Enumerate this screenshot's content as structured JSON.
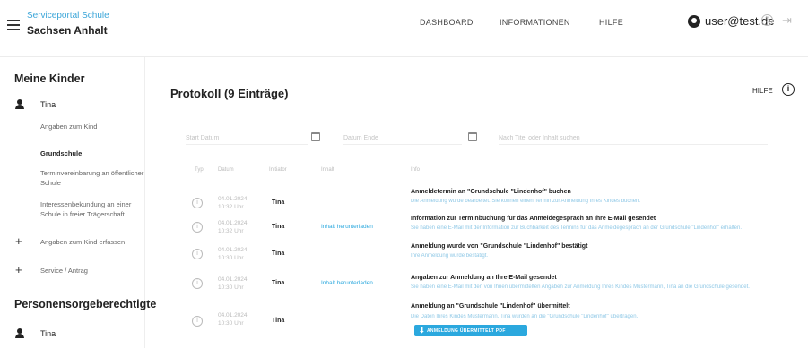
{
  "header": {
    "brand_sub": "Serviceportal Schule",
    "brand_main": "Sachsen Anhalt",
    "nav": {
      "dashboard": "DASHBOARD",
      "informationen": "INFORMATIONEN",
      "hilfe": "HILFE"
    },
    "user_email": "user@test.de"
  },
  "sidebar": {
    "section_kinder": "Meine Kinder",
    "child_name": "Tina",
    "items": {
      "angaben": "Angaben zum Kind",
      "grundschule": "Grundschule",
      "termin": "Terminvereinbarung an öffentlicher Schule",
      "interesse": "Interessenbekundung an einer Schule in freier Trägerschaft"
    },
    "add_kind": "Angaben zum Kind erfassen",
    "service": "Service / Antrag",
    "section_sorge": "Personensorgeberechtigte",
    "sorge_name": "Tina"
  },
  "main": {
    "title": "Protokoll (9 Einträge)",
    "help_label": "HILFE",
    "filters": {
      "start_placeholder": "Start Datum",
      "end_placeholder": "Datum Ende",
      "search_placeholder": "Nach Titel oder Inhalt suchen"
    },
    "columns": {
      "typ": "Typ",
      "datum": "Datum",
      "initiator": "Initiator",
      "inhalt": "Inhalt",
      "info": "Info"
    },
    "rows": [
      {
        "date": "04.01.2024",
        "time": "10:32 Uhr",
        "person": "Tina",
        "link": "",
        "title": "Anmeldetermin an \"Grundschule \"Lindenhof\" buchen",
        "desc": "Die Anmeldung wurde bearbeitet. Sie können einen Termin zur Anmeldung Ihres Kindes buchen."
      },
      {
        "date": "04.01.2024",
        "time": "10:32 Uhr",
        "person": "Tina",
        "link": "Inhalt herunterladen",
        "title": "Information zur Terminbuchung für das Anmeldegespräch an Ihre E-Mail gesendet",
        "desc": "Sie haben eine E-Mail mit der Information zur Buchbarkeit des Termins für das Anmeldegespräch an der Grundschule \"Lindenhof\" erhalten."
      },
      {
        "date": "04.01.2024",
        "time": "10:30 Uhr",
        "person": "Tina",
        "link": "",
        "title": "Anmeldung wurde von \"Grundschule \"Lindenhof\" bestätigt",
        "desc": "Ihre Anmeldung wurde bestätigt."
      },
      {
        "date": "04.01.2024",
        "time": "10:30 Uhr",
        "person": "Tina",
        "link": "Inhalt herunterladen",
        "title": "Angaben zur Anmeldung an Ihre E-Mail gesendet",
        "desc": "Sie haben eine E-Mail mit den von Ihnen übermittelten Angaben zur Anmeldung Ihres Kindes Mustermann, Tina an die Grundschule gesendet."
      },
      {
        "date": "04.01.2024",
        "time": "10:30 Uhr",
        "person": "Tina",
        "link": "",
        "title": "Anmeldung an \"Grundschule \"Lindenhof\" übermittelt",
        "desc": "Die Daten Ihres Kindes Mustermann, Tina wurden an die \"Grundschule \"Lindenhof\" übertragen."
      }
    ],
    "pdf_button": "ANMELDUNG ÜBERMITTELT PDF"
  },
  "colors": {
    "accent": "#2ba8de",
    "brand_sub": "#3aa5d8"
  }
}
